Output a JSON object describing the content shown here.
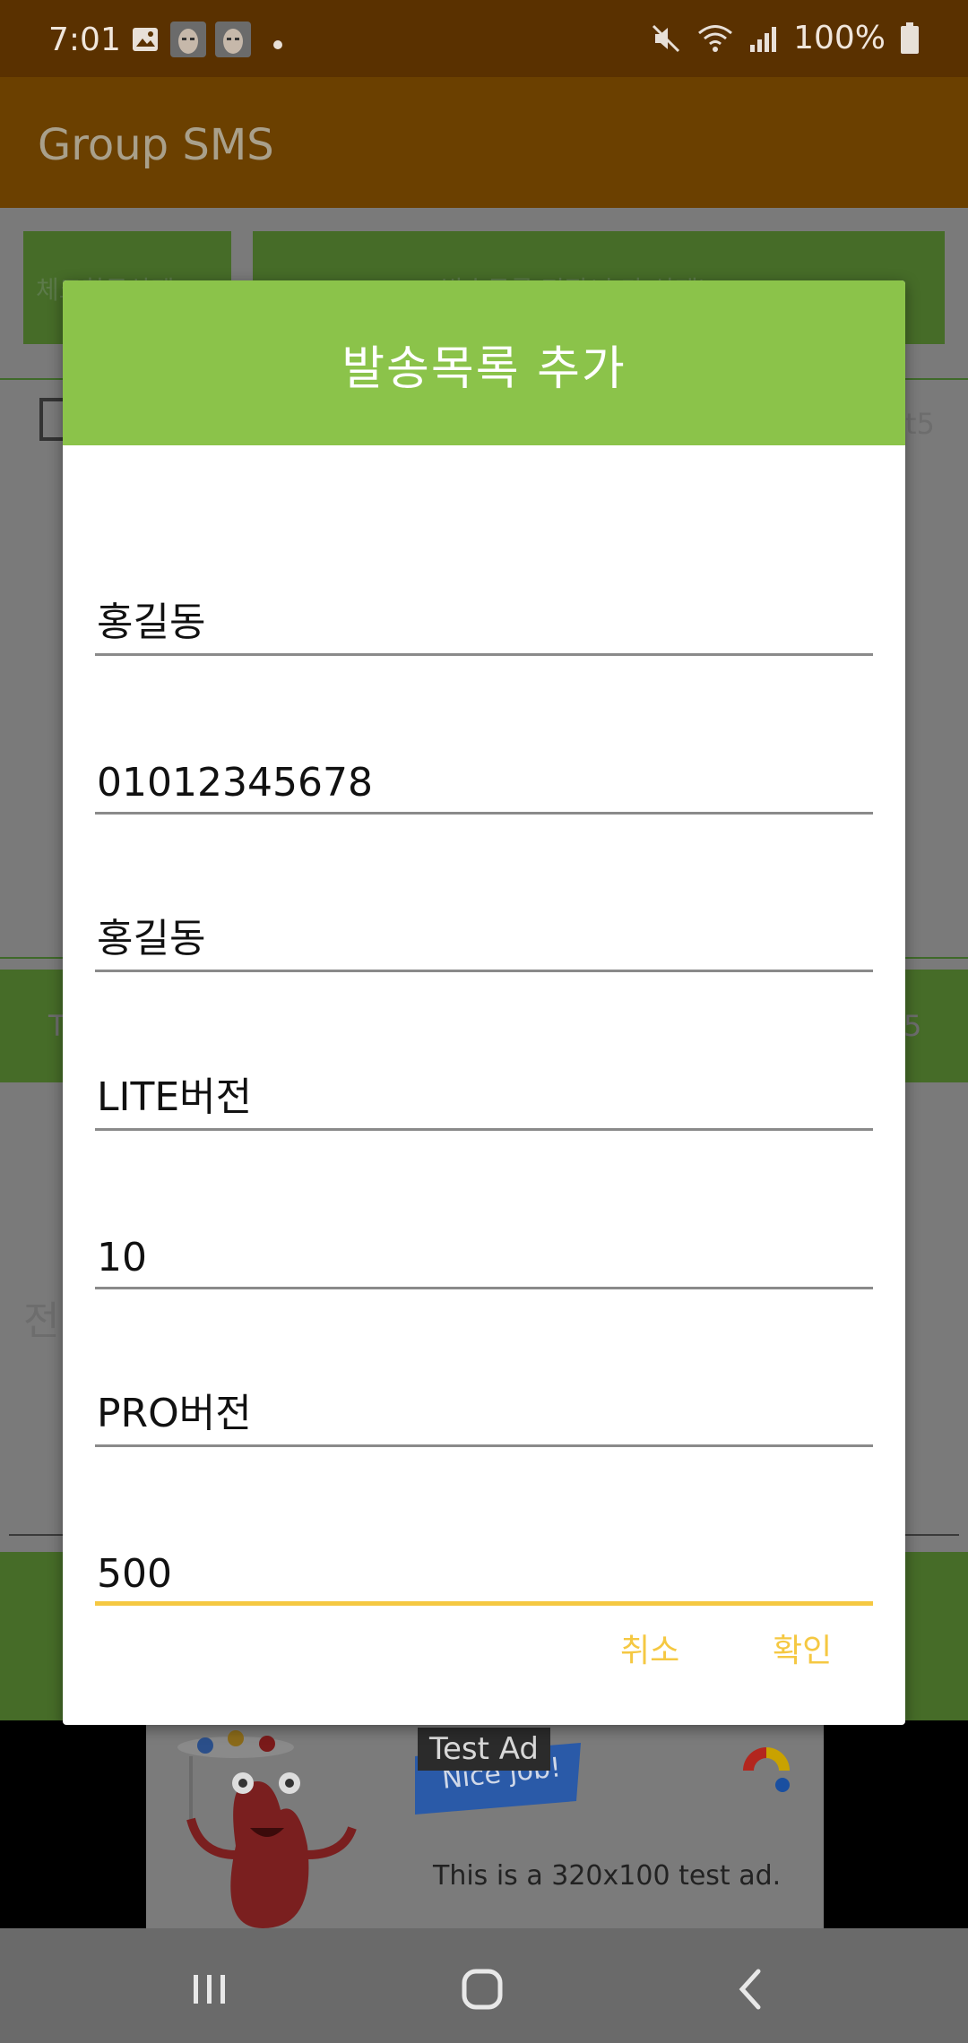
{
  "status_bar": {
    "time": "7:01",
    "battery": "100%"
  },
  "app_bar": {
    "title": "Group SMS"
  },
  "background": {
    "left_button": "체크항목삭제",
    "right_button": "발송목록 편집(추가/삭제)",
    "row_right_text": "t5",
    "green_bar_left": "T",
    "green_bar_right": "5",
    "side_text": "전"
  },
  "dialog": {
    "title": "발송목록 추가",
    "fields": [
      {
        "value": "홍길동"
      },
      {
        "value": "01012345678"
      },
      {
        "value": "홍길동"
      },
      {
        "value": "LITE버전"
      },
      {
        "value": "10"
      },
      {
        "value": "PRO버전"
      },
      {
        "value": "500"
      }
    ],
    "cancel_label": "취소",
    "ok_label": "확인"
  },
  "ad": {
    "label": "Test Ad",
    "banner_text": "Nice job!",
    "text": "This is a 320x100 test ad."
  },
  "colors": {
    "accent": "#8bc34a",
    "focus": "#f5c842",
    "status_bar": "#5a3100",
    "app_bar": "#6b4000"
  }
}
